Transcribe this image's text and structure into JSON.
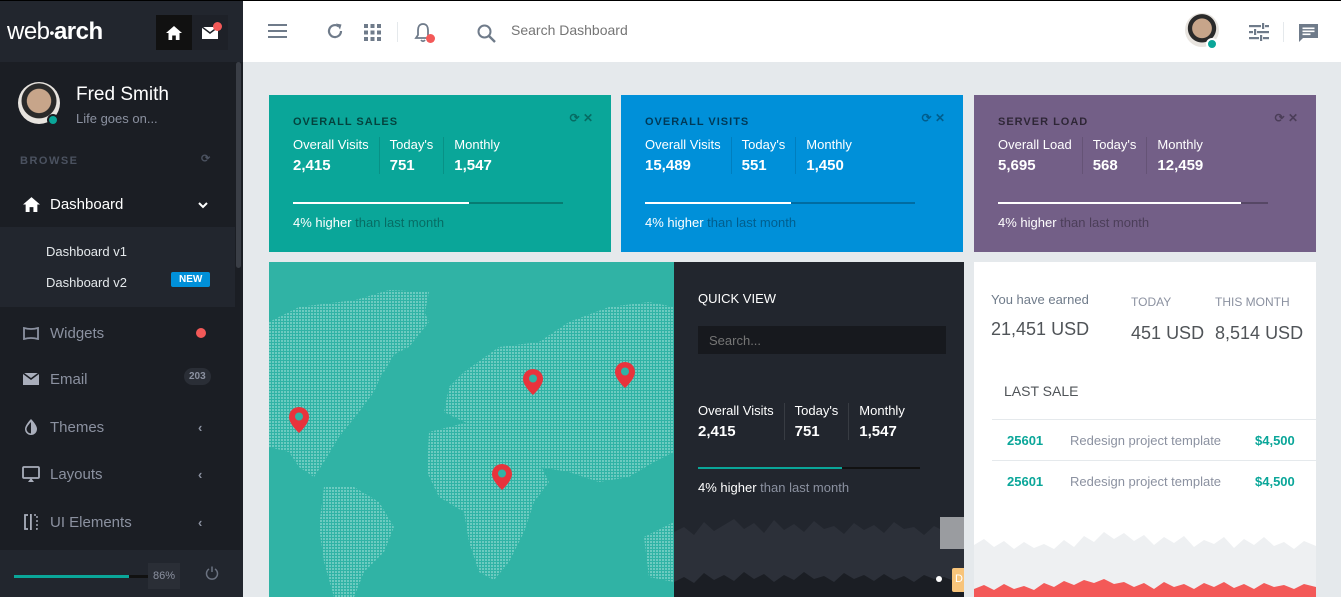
{
  "sidebar": {
    "logo_light": "web",
    "logo_dot": "•",
    "logo_bold": "arch",
    "user": {
      "name": "Fred Smith",
      "status": "Life goes on..."
    },
    "section_label": "BROWSE",
    "nav": [
      {
        "label": "Dashboard",
        "icon": "home-icon",
        "active": true,
        "arrow": "⌄"
      },
      {
        "label": "Widgets",
        "icon": "widgets-icon",
        "indicator": "red-dot"
      },
      {
        "label": "Email",
        "icon": "email-icon",
        "badge": "203"
      },
      {
        "label": "Themes",
        "icon": "drop-icon",
        "arrow": "‹"
      },
      {
        "label": "Layouts",
        "icon": "monitor-icon",
        "arrow": "‹"
      },
      {
        "label": "UI Elements",
        "icon": "ui-elements-icon",
        "arrow": "‹"
      }
    ],
    "submenu": [
      {
        "label": "Dashboard v1"
      },
      {
        "label": "Dashboard v2",
        "badge": "NEW"
      }
    ],
    "footer": {
      "progress_percent": 86,
      "progress_label": "86%"
    }
  },
  "header": {
    "search_placeholder": "Search Dashboard"
  },
  "tiles": [
    {
      "title": "OVERALL SALES",
      "color": "#0aa699",
      "stats": [
        {
          "label": "Overall Visits",
          "value": "2,415"
        },
        {
          "label": "Today's",
          "value": "751"
        },
        {
          "label": "Monthly",
          "value": "1,547"
        }
      ],
      "progress_percent": 65,
      "trend_highlight": "4% higher",
      "trend_rest": "than last month"
    },
    {
      "title": "OVERALL VISITS",
      "color": "#0090d9",
      "stats": [
        {
          "label": "Overall Visits",
          "value": "15,489"
        },
        {
          "label": "Today's",
          "value": "551"
        },
        {
          "label": "Monthly",
          "value": "1,450"
        }
      ],
      "progress_percent": 54,
      "trend_highlight": "4% higher",
      "trend_rest": "than last month"
    },
    {
      "title": "SERVER LOAD",
      "color": "#735f87",
      "stats": [
        {
          "label": "Overall Load",
          "value": "5,695"
        },
        {
          "label": "Today's",
          "value": "568"
        },
        {
          "label": "Monthly",
          "value": "12,459"
        }
      ],
      "progress_percent": 90,
      "trend_highlight": "4% higher",
      "trend_rest": "than last month"
    }
  ],
  "map": {
    "pins": [
      {
        "region": "north-america"
      },
      {
        "region": "eastern-europe"
      },
      {
        "region": "siberia"
      },
      {
        "region": "central-africa"
      }
    ]
  },
  "quick_view": {
    "title": "QUICK VIEW",
    "search_placeholder": "Search...",
    "stats": [
      {
        "label": "Overall Visits",
        "value": "2,415"
      },
      {
        "label": "Today's",
        "value": "751"
      },
      {
        "label": "Monthly",
        "value": "1,547"
      }
    ],
    "progress_percent": 65,
    "trend_highlight": "4% higher",
    "trend_rest": "than last month",
    "tag_letter": "D"
  },
  "earnings": {
    "earned_label": "You have earned",
    "earned_value": "21,451",
    "today_label": "TODAY",
    "today_value": "451",
    "month_label": "THIS MONTH",
    "month_value": "8,514",
    "currency": "USD",
    "last_sale_label": "LAST SALE",
    "sales": [
      {
        "id": "25601",
        "description": "Redesign project template",
        "amount": "$4,500"
      },
      {
        "id": "25601",
        "description": "Redesign project template",
        "amount": "$4,500"
      }
    ]
  }
}
